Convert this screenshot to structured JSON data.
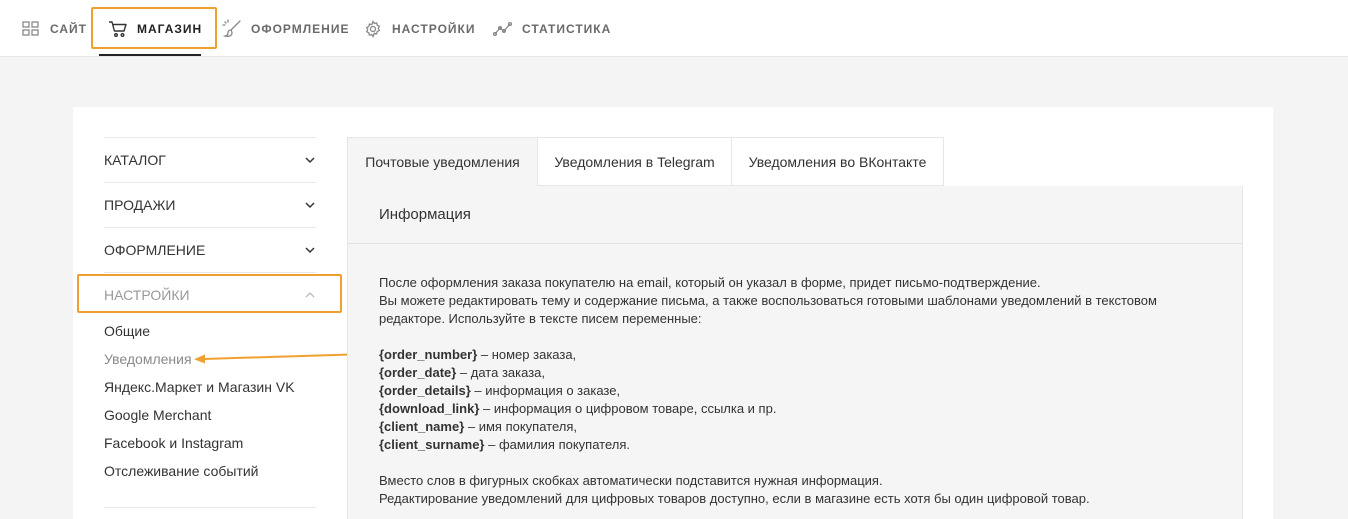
{
  "topnav": {
    "items": [
      {
        "label": "САЙТ",
        "icon": "grid-icon"
      },
      {
        "label": "МАГАЗИН",
        "icon": "cart-icon"
      },
      {
        "label": "ОФОРМЛЕНИЕ",
        "icon": "brush-icon"
      },
      {
        "label": "НАСТРОЙКИ",
        "icon": "gear-icon"
      },
      {
        "label": "СТАТИСТИКА",
        "icon": "line-chart-icon"
      }
    ],
    "active_index": 1
  },
  "sidebar": {
    "sections": [
      {
        "label": "КАТАЛОГ",
        "expanded": false
      },
      {
        "label": "ПРОДАЖИ",
        "expanded": false
      },
      {
        "label": "ОФОРМЛЕНИЕ",
        "expanded": false
      },
      {
        "label": "НАСТРОЙКИ",
        "expanded": true
      }
    ],
    "subitems": [
      {
        "label": "Общие"
      },
      {
        "label": "Уведомления"
      },
      {
        "label": "Яндекс.Маркет и Магазин VK"
      },
      {
        "label": "Google Merchant"
      },
      {
        "label": "Facebook и Instagram"
      },
      {
        "label": "Отслеживание событий"
      }
    ],
    "current_subitem": 1
  },
  "tabs": [
    {
      "label": "Почтовые уведомления"
    },
    {
      "label": "Уведомления в Telegram"
    },
    {
      "label": "Уведомления во ВКонтакте"
    }
  ],
  "panel": {
    "title": "Информация",
    "intro_line1": "После оформления заказа покупателю на email, который он указал в форме, придет письмо-подтверждение.",
    "intro_line2": "Вы можете редактировать тему и содержание письма, а также воспользоваться готовыми шаблонами уведомлений в текстовом",
    "intro_line3": "редакторе. Используйте в тексте писем переменные:",
    "variables": [
      {
        "name": "{order_number}",
        "desc": " – номер заказа,"
      },
      {
        "name": "{order_date}",
        "desc": " – дата заказа,"
      },
      {
        "name": "{order_details}",
        "desc": " – информация о заказе,"
      },
      {
        "name": "{download_link}",
        "desc": " – информация о цифровом товаре, ссылка и пр."
      },
      {
        "name": "{client_name}",
        "desc": " – имя покупателя,"
      },
      {
        "name": "{client_surname}",
        "desc": " – фамилия покупателя."
      }
    ],
    "outro_line1": "Вместо слов в фигурных скобках автоматически подставится нужная информация.",
    "outro_line2": "Редактирование уведомлений для цифровых товаров доступно, если в магазине есть хотя бы один цифровой товар."
  },
  "colors": {
    "highlight": "#f0a030",
    "active_text": "#222222",
    "muted_text": "#999999"
  }
}
